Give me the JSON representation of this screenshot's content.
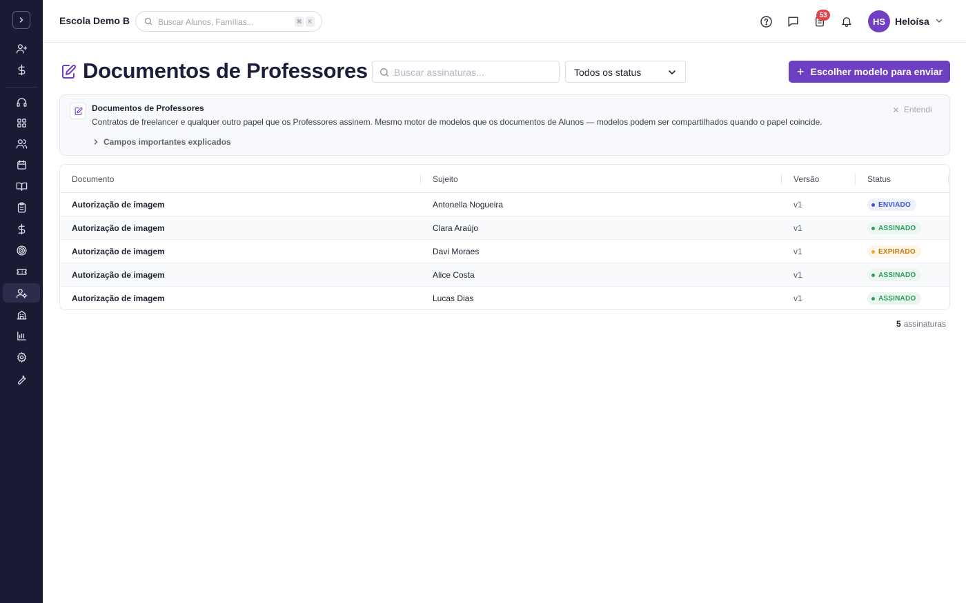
{
  "app": {
    "school_name": "Escola Demo B"
  },
  "global_search": {
    "placeholder": "Buscar Alunos, Famílias...",
    "shortcut_keys": [
      "⌘",
      "K"
    ]
  },
  "header": {
    "notification_badge": "53",
    "user_initials": "HS",
    "user_name": "Heloísa"
  },
  "sidebar": {
    "items": [
      {
        "icon": "user-plus-icon"
      },
      {
        "icon": "dollar-icon"
      },
      {
        "icon": "headset-icon"
      },
      {
        "icon": "dashboard-icon"
      },
      {
        "icon": "users-icon"
      },
      {
        "icon": "calendar-icon"
      },
      {
        "icon": "book-icon"
      },
      {
        "icon": "clipboard-icon"
      },
      {
        "icon": "dollar-icon"
      },
      {
        "icon": "target-icon"
      },
      {
        "icon": "ticket-icon"
      },
      {
        "icon": "user-settings-icon"
      },
      {
        "icon": "building-icon"
      },
      {
        "icon": "bar-chart-icon"
      },
      {
        "icon": "gear-icon"
      },
      {
        "icon": "wrench-icon"
      }
    ]
  },
  "page": {
    "title": "Documentos de Professores",
    "search_placeholder": "Buscar assinaturas...",
    "status_filter": "Todos os status",
    "primary_button": "Escolher modelo para enviar"
  },
  "info": {
    "title": "Documentos de Professores",
    "description": "Contratos de freelancer e qualquer outro papel que os Professores assinem. Mesmo motor de modelos que os documentos de Alunos — modelos podem ser compartilhados quando o papel coincide.",
    "link": "Campos importantes explicados",
    "dismiss": "Entendi"
  },
  "table": {
    "columns": [
      "Documento",
      "Sujeito",
      "Versão",
      "Status"
    ],
    "rows": [
      {
        "documento": "Autorização de imagem",
        "sujeito": "Antonella Nogueira",
        "versao": "v1",
        "status": "ENVIADO"
      },
      {
        "documento": "Autorização de imagem",
        "sujeito": "Clara Araújo",
        "versao": "v1",
        "status": "ASSINADO"
      },
      {
        "documento": "Autorização de imagem",
        "sujeito": "Davi Moraes",
        "versao": "v1",
        "status": "EXPIRADO"
      },
      {
        "documento": "Autorização de imagem",
        "sujeito": "Alice Costa",
        "versao": "v1",
        "status": "ASSINADO"
      },
      {
        "documento": "Autorização de imagem",
        "sujeito": "Lucas Dias",
        "versao": "v1",
        "status": "ASSINADO"
      }
    ]
  },
  "footer": {
    "count": "5",
    "count_label": "assinaturas"
  },
  "colors": {
    "sidebar_bg": "#1a1a35",
    "accent": "#6e3fc0",
    "status_enviado": "#3b55d9",
    "status_assinado": "#2e9a5c",
    "status_expirado": "#c27a12"
  }
}
